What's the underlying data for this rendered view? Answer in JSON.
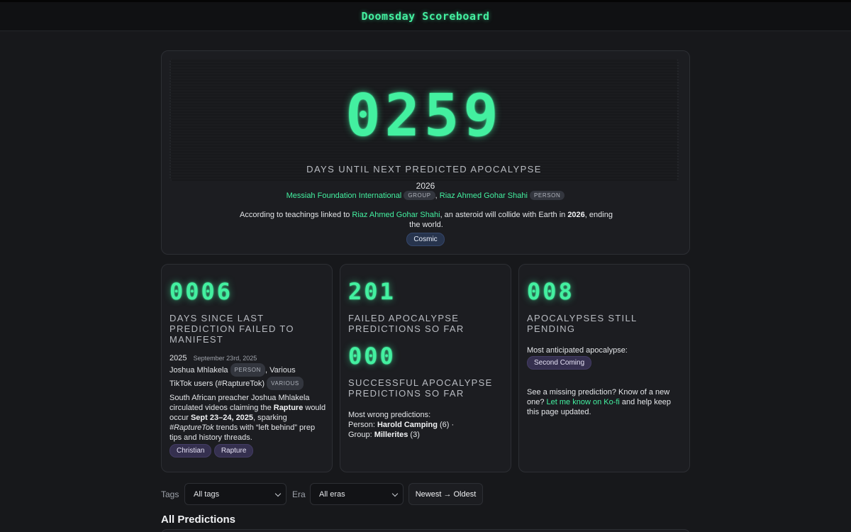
{
  "site": {
    "title": "Doomsday Scoreboard"
  },
  "hero": {
    "days": "0259",
    "label": "DAYS UNTIL NEXT PREDICTED APOCALYPSE",
    "year": "2026",
    "predictors": [
      {
        "name": "Messiah Foundation International",
        "type": "GROUP"
      },
      {
        "name": "Riaz Ahmed Gohar Shahi",
        "type": "PERSON"
      }
    ],
    "separator": ",",
    "desc_pre": "According to teachings linked to ",
    "desc_link": "Riaz Ahmed Gohar Shahi",
    "desc_mid": ", an asteroid will collide with Earth in ",
    "desc_bold": "2026",
    "desc_post": ", ending the world.",
    "tag": "Cosmic"
  },
  "since_last": {
    "days": "0006",
    "label": "DAYS SINCE LAST PREDICTION FAILED TO MANIFEST",
    "year": "2025",
    "date": "September 23rd, 2025",
    "predictor1": "Joshua Mhlakela",
    "predictor1_type": "PERSON",
    "predictor2_pre": ", Various",
    "predictor2": "TikTok users (#RaptureTok)",
    "predictor2_type": "VARIOUS",
    "d1": "South African preacher Joshua Mhlakela circulated videos claiming the ",
    "d_b1": "Rapture",
    "d2": " would occur ",
    "d_b2": "Sept 23–24, 2025",
    "d3": ", sparking ",
    "d_i": "#RaptureTok",
    "d4": " trends with “left behind” prep tips and history threads.",
    "tags": [
      "Christian",
      "Rapture"
    ]
  },
  "failed": {
    "count": "201",
    "label": "FAILED APOCALYPSE PREDICTIONS SO FAR",
    "success_count": "000",
    "success_label": "SUCCESSFUL APOCALYPSE PREDICTIONS SO FAR",
    "most_wrong_title": "Most wrong predictions:",
    "person_label": "Person: ",
    "person_name": "Harold Camping",
    "person_count": " (6) ·",
    "group_label": "Group: ",
    "group_name": "Millerites",
    "group_count": " (3)"
  },
  "pending": {
    "count": "008",
    "label": "APOCALYPSES STILL PENDING",
    "anticipated_title": "Most anticipated apocalypse:",
    "anticipated_tag": "Second Coming",
    "cta_pre": "See a missing prediction? Know of a new one? ",
    "cta_link": "Let me know on Ko-fi",
    "cta_post": " and help keep this page updated."
  },
  "filters": {
    "tags_label": "Tags",
    "tags_value": "All tags",
    "era_label": "Era",
    "era_value": "All eras",
    "sort_label": "Newest → Oldest"
  },
  "list": {
    "title": "All Predictions"
  },
  "colors": {
    "accent": "#43f0a0",
    "background": "#17181b",
    "card": "#1c1d21"
  }
}
